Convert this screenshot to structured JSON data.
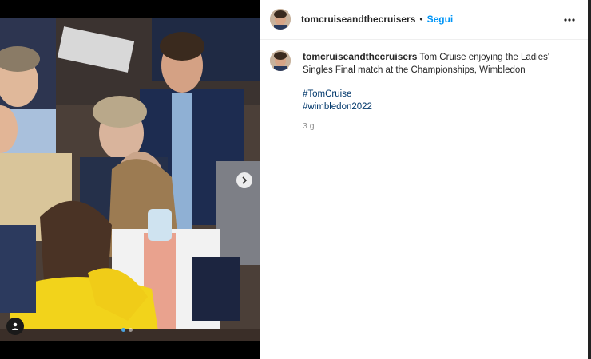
{
  "post": {
    "username": "tomcruiseandthecruisers",
    "separator": "•",
    "follow_label": "Segui",
    "more_icon": "more-horizontal-icon",
    "caption_text": "Tom Cruise enjoying the Ladies' Singles Final match at the Championships, Wimbledon",
    "hashtags": [
      "#TomCruise",
      "#wimbledon2022"
    ],
    "timestamp": "3 g"
  },
  "carousel": {
    "next_icon": "chevron-right-icon",
    "tag_icon": "user-tag-icon",
    "slide_count": 2,
    "active_slide": 1
  },
  "colors": {
    "follow": "#0095f6",
    "hashtag": "#00376b",
    "muted": "#8e8e8e"
  }
}
